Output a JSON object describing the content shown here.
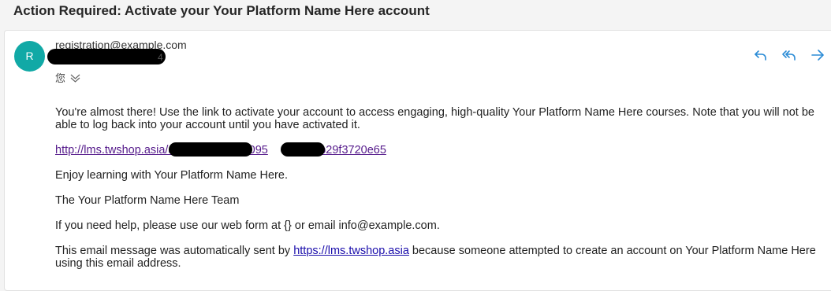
{
  "subject": "Action Required: Activate your Your Platform Name Here account",
  "sender": {
    "avatar_letter": "R",
    "email": "registration@example.com",
    "recipient_suffix": "4",
    "details_label": "您"
  },
  "actions": {
    "reply_icon": "reply-icon",
    "reply_all_icon": "reply-all-icon",
    "forward_icon": "forward-icon"
  },
  "body": {
    "intro": "You're almost there! Use the link to activate your account to access engaging, high-quality Your Platform Name Here courses. Note that you will not be able to log back into your account until you have activated it.",
    "activation_link_start": "http://lms.twshop.asia/a",
    "activation_link_mid": "1a095",
    "activation_link_end": "e0cb29f3720e65",
    "enjoy": "Enjoy learning with Your Platform Name Here.",
    "signoff": "The Your Platform Name Here Team",
    "help": "If you need help, please use our web form at {} or email info@example.com.",
    "auto_prefix": "This email message was automatically sent by ",
    "auto_link": "https://lms.twshop.asia",
    "auto_suffix": " because someone attempted to create an account on Your Platform Name Here using this email address."
  },
  "colors": {
    "avatar": "#11a9a6",
    "icon_blue": "#2a8bd6",
    "visited_link": "#551a8b",
    "link": "#1a0dab"
  }
}
